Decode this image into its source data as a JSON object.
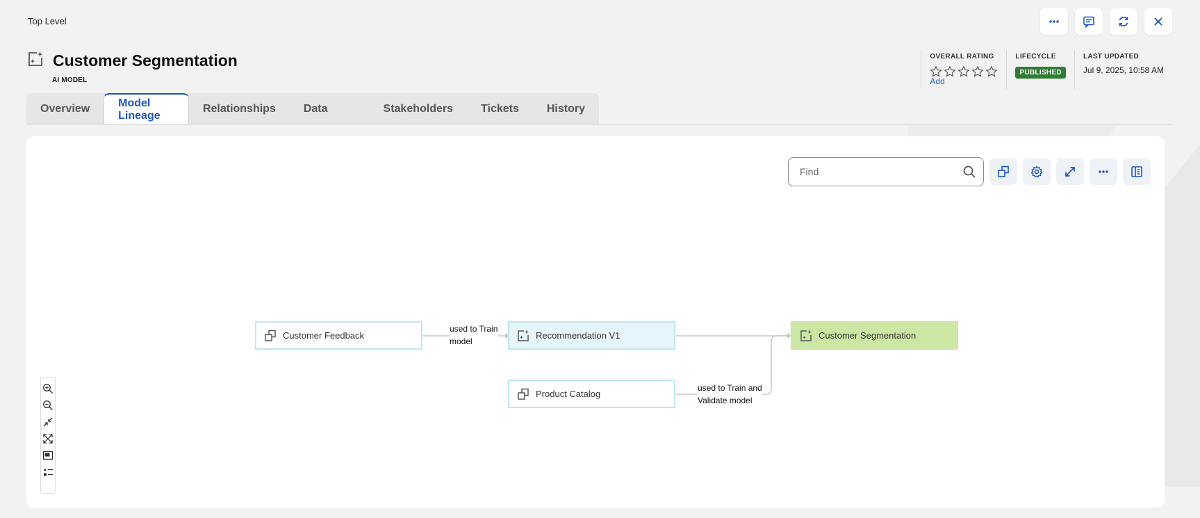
{
  "breadcrumb": "Top Level",
  "header": {
    "title": "Customer Segmentation",
    "subtitle": "AI MODEL"
  },
  "top_actions": [
    "more-icon",
    "comment-icon",
    "refresh-icon",
    "close-icon"
  ],
  "meta": {
    "rating_label": "OVERALL RATING",
    "rating_value": 0,
    "rating_max": 5,
    "rating_add": "Add",
    "lifecycle_label": "LIFECYCLE",
    "lifecycle_value": "PUBLISHED",
    "updated_label": "LAST UPDATED",
    "updated_value": "Jul 9, 2025, 10:58 AM"
  },
  "tabs": [
    {
      "label": "Overview"
    },
    {
      "label": "Model Lineage"
    },
    {
      "label": "Relationships"
    },
    {
      "label": "Data"
    },
    {
      "label": "Stakeholders"
    },
    {
      "label": "Tickets"
    },
    {
      "label": "History"
    }
  ],
  "active_tab": "Model Lineage",
  "find": {
    "placeholder": "Find"
  },
  "canvas_tools": [
    "copy-icon",
    "settings-icon",
    "expand-icon",
    "more-icon",
    "panel-icon"
  ],
  "lineage": {
    "nodes": [
      {
        "id": "customer-feedback",
        "label": "Customer Feedback",
        "icon": "dataset-icon"
      },
      {
        "id": "recommendation-v1",
        "label": "Recommendation V1",
        "icon": "ai-model-icon"
      },
      {
        "id": "customer-segmentation",
        "label": "Customer Segmentation",
        "icon": "ai-model-icon"
      },
      {
        "id": "product-catalog",
        "label": "Product Catalog",
        "icon": "dataset-icon"
      }
    ],
    "edges": [
      {
        "from": "customer-feedback",
        "to": "recommendation-v1",
        "label_line1": "used to Train",
        "label_line2": "model"
      },
      {
        "from": "recommendation-v1",
        "to": "customer-segmentation",
        "label_line1": "",
        "label_line2": ""
      },
      {
        "from": "product-catalog",
        "to": "customer-segmentation",
        "label_line1": "used to Train and",
        "label_line2": "Validate model"
      }
    ]
  },
  "zoom_tools": [
    "zoom-in-icon",
    "zoom-out-icon",
    "fit-icon",
    "fullscreen-icon",
    "minimap-icon",
    "legend-icon"
  ],
  "colors": {
    "accent": "#1a56c8",
    "published": "#2e7d32",
    "focus_node": "#cce6a4",
    "node_border": "#bfe6f4"
  }
}
